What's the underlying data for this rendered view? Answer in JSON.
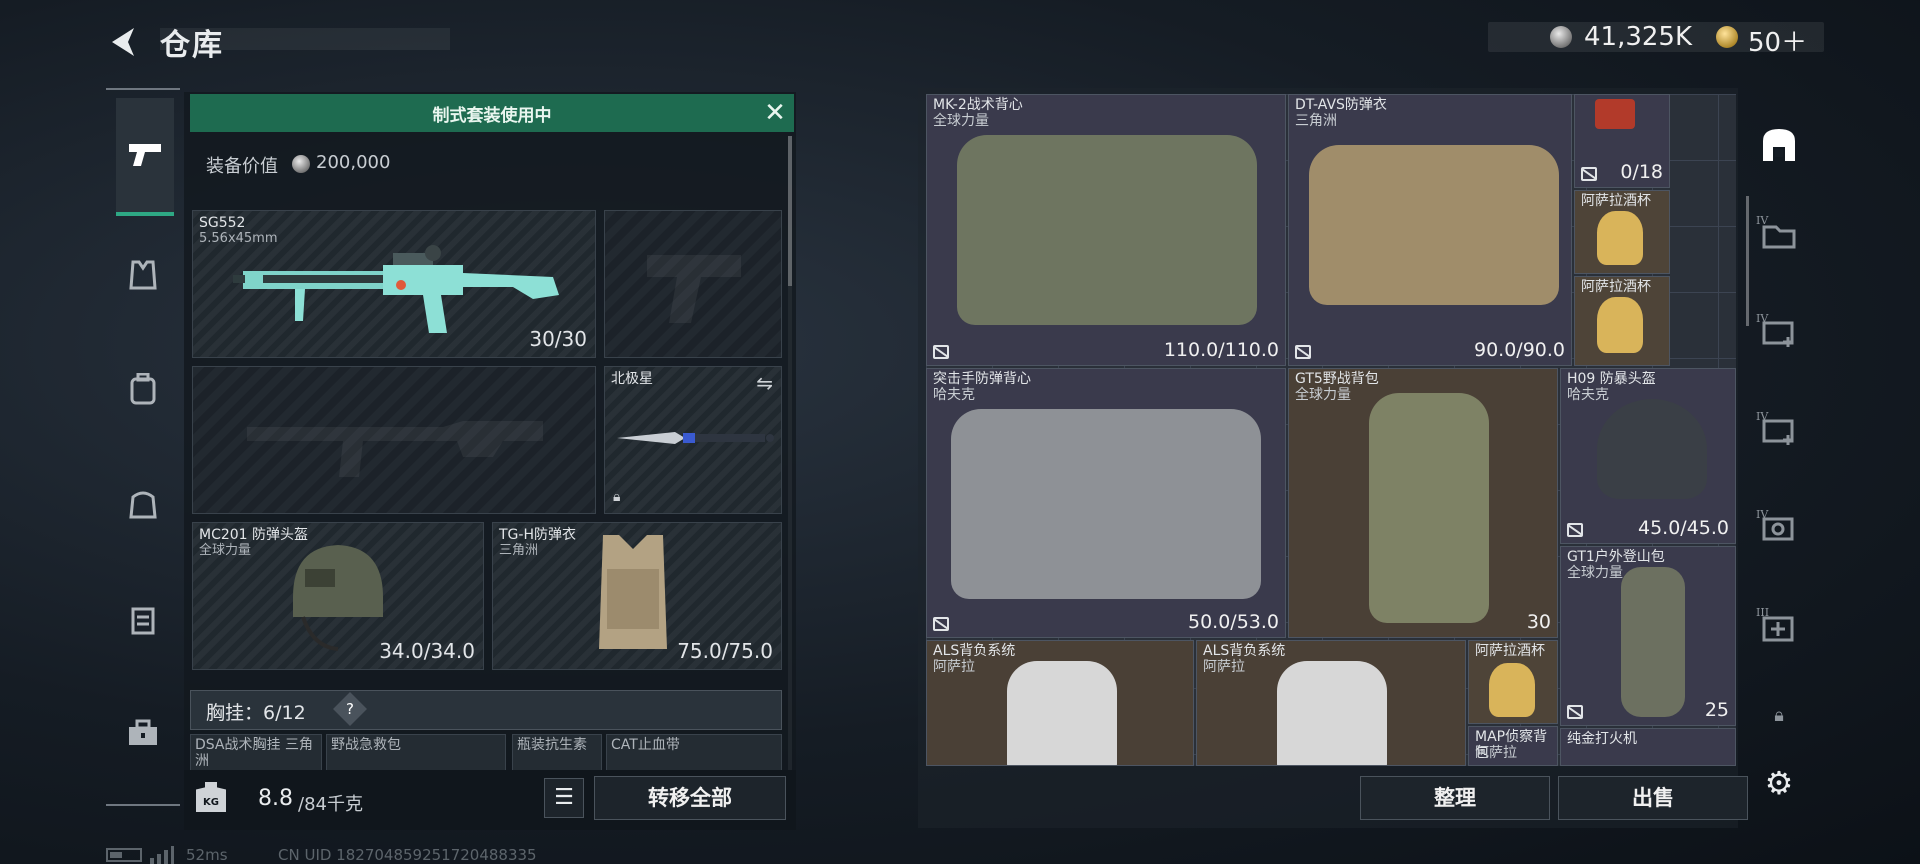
{
  "header": {
    "title": "仓库",
    "money": "41,325K",
    "gold": "50＋"
  },
  "left_nav": [
    "gun-icon",
    "vest-icon",
    "backpack-icon",
    "bag-icon",
    "case-icon",
    "toolbox-icon"
  ],
  "loadout": {
    "banner": "制式套装使用中",
    "equip_value_label": "装备价值",
    "equip_value": "200,000",
    "primary": {
      "name": "SG552",
      "sub": "5.56x45mm",
      "value": "30/30"
    },
    "melee": {
      "name": "北极星"
    },
    "helmet": {
      "name": "MC201 防弹头盔",
      "sub": "全球力量",
      "value": "34.0/34.0"
    },
    "armor": {
      "name": "TG-H防弹衣",
      "sub": "三角洲",
      "value": "75.0/75.0"
    },
    "chest_rig_label": "胸挂：6/12",
    "chest_rig_help": "?",
    "rig_items": [
      "DSA战术胸挂 三角洲",
      "野战急救包",
      "瓶装抗生素",
      "CAT止血带"
    ],
    "weight": "8.8",
    "weight_max": "/84千克",
    "transfer_all": "转移全部"
  },
  "warehouse": {
    "items": [
      {
        "name": "MK-2战术背心",
        "sub": "全球力量",
        "value": "110.0/110.0"
      },
      {
        "name": "DT-AVS防弹衣",
        "sub": "三角洲",
        "value": "90.0/90.0"
      },
      {
        "name": "",
        "sub": "",
        "value": "0/18"
      },
      {
        "name": "阿萨拉酒杯",
        "sub": "",
        "value": ""
      },
      {
        "name": "阿萨拉酒杯",
        "sub": "",
        "value": ""
      },
      {
        "name": "突击手防弹背心",
        "sub": "哈夫克",
        "value": "50.0/53.0"
      },
      {
        "name": "GT5野战背包",
        "sub": "全球力量",
        "value": "30"
      },
      {
        "name": "H09 防暴头盔",
        "sub": "哈夫克",
        "value": "45.0/45.0"
      },
      {
        "name": "GT1户外登山包",
        "sub": "全球力量",
        "value": "25"
      },
      {
        "name": "ALS背负系统",
        "sub": "阿萨拉",
        "value": ""
      },
      {
        "name": "ALS背负系统",
        "sub": "阿萨拉",
        "value": ""
      },
      {
        "name": "阿萨拉酒杯",
        "sub": "",
        "value": ""
      },
      {
        "name": "MAP侦察背包",
        "sub": "阿萨拉",
        "value": ""
      },
      {
        "name": "纯金打火机",
        "sub": "",
        "value": ""
      }
    ],
    "sort": "整理",
    "sell": "出售"
  },
  "right_nav": {
    "tags": [
      "IV",
      "IV",
      "IV",
      "IV",
      "III"
    ]
  },
  "status": {
    "ping": "52ms",
    "uid": "CN UID 182704859251720488335"
  },
  "colors": {
    "accent": "#2ea884",
    "banner": "#1e6b50"
  }
}
